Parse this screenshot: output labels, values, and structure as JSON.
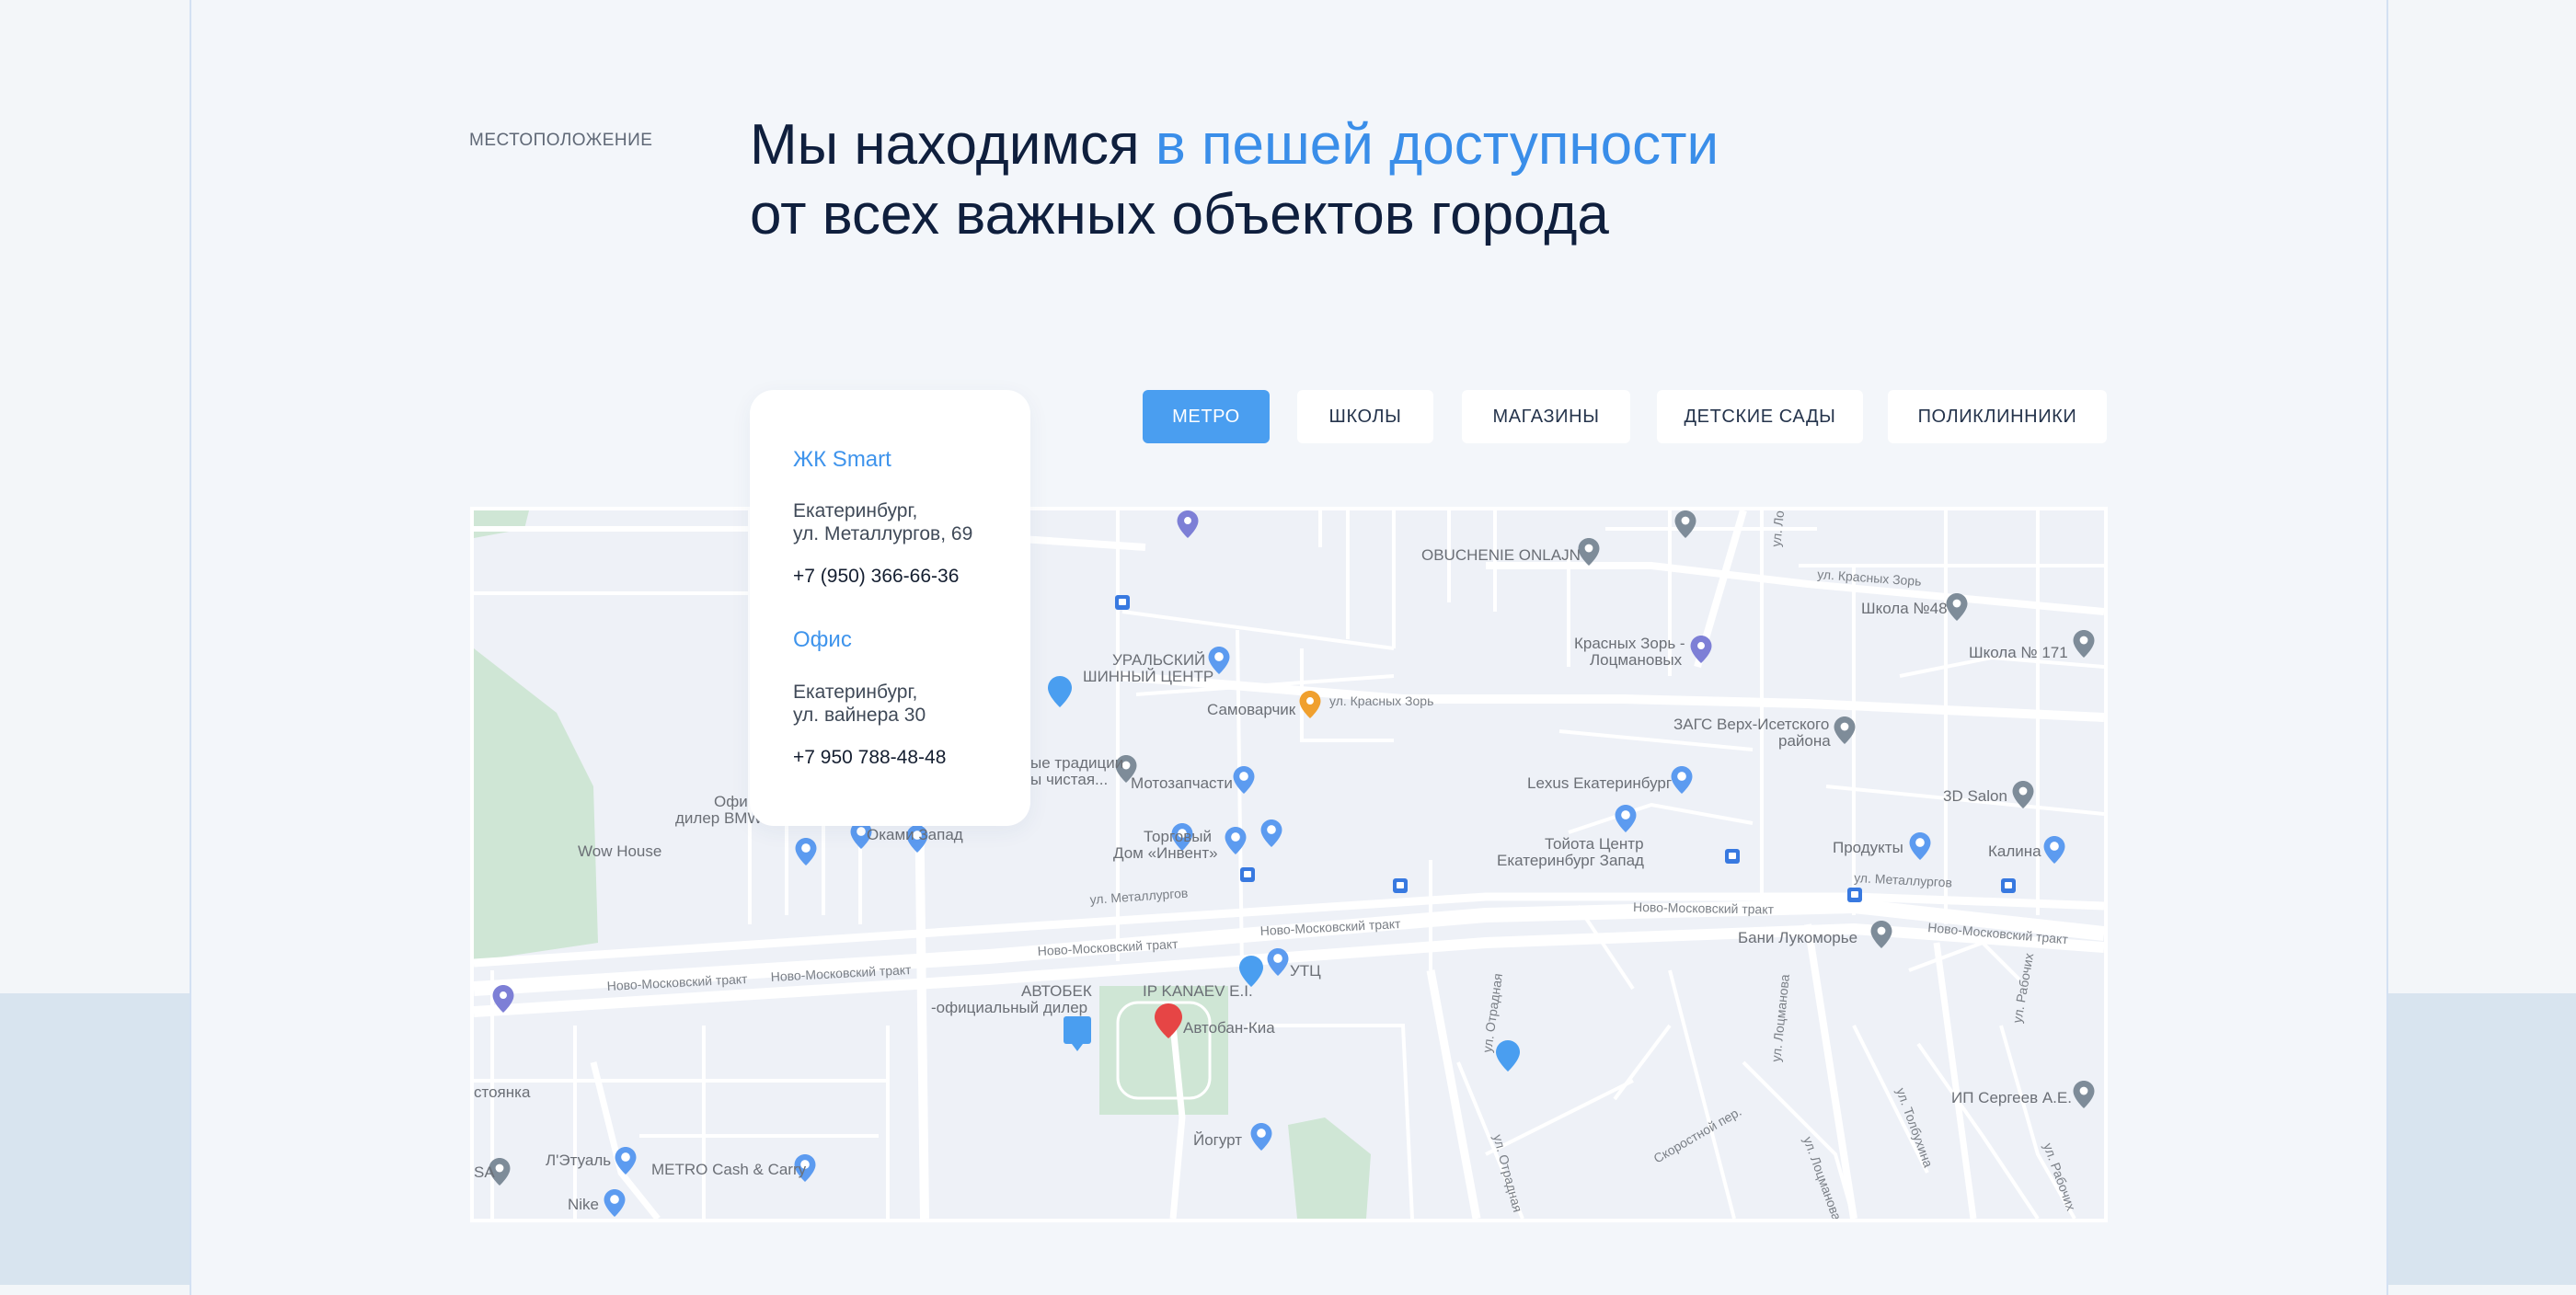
{
  "section": {
    "label": "МЕСТОПОЛОЖЕНИЕ",
    "title_part1": "Мы находимся ",
    "title_accent": "в пешей доступности",
    "title_line2": "от всех важных объектов города"
  },
  "tabs": [
    {
      "label": "МЕТРО",
      "active": true
    },
    {
      "label": "ШКОЛЫ",
      "active": false
    },
    {
      "label": "МАГАЗИНЫ",
      "active": false
    },
    {
      "label": "ДЕТСКИЕ САДЫ",
      "active": false
    },
    {
      "label": "ПОЛИКЛИННИКИ",
      "active": false
    }
  ],
  "info": {
    "place1": {
      "name": "ЖК Smart",
      "addr1": "Екатеринбург,",
      "addr2": "ул. Металлургов, 69",
      "phone": "+7 (950) 366-66-36"
    },
    "place2": {
      "name": "Офис",
      "addr1": "Екатеринбург,",
      "addr2": "ул. вайнера 30",
      "phone": "+7 950 788-48-48"
    }
  },
  "map": {
    "pois": {
      "obuchenie": "OBUCHENIE ONLAJN",
      "uralsky1": "УРАЛЬСКИЙ",
      "uralsky2": "ШИННЫЙ ЦЕНТР",
      "samovarchik": "Самоварчик",
      "tradicii1": "ые традиции",
      "tradicii2": "ы чистая...",
      "motozap": "Мотозапчасти",
      "torg1": "Торговый",
      "torg2": "Дом «Инвент»",
      "okami": "Оками Запад",
      "wowhouse": "Wow House",
      "ofic1": "Офи",
      "ofic2": "дилер BMW",
      "krasnye1": "Красных Зорь -",
      "krasnye2": "Лоцмановых",
      "zags1": "ЗАГС Верх-Исетского",
      "zags2": "района",
      "shkola48": "Школа №48",
      "shkola171": "Школа № 171",
      "lexus": "Lexus Екатеринбург",
      "toyota1": "Тойота Центр",
      "toyota2": "Екатеринбург Запад",
      "salon3d": "3D Salon",
      "produkty": "Продукты",
      "kalina": "Калина",
      "bani": "Бани Лукоморье",
      "avtobek1": "АВТОБЕК",
      "avtobek2": "-официальный дилер",
      "kanaev": "IP KANAEV E.I.",
      "utc": "УТЦ",
      "avtoban": "Автобан-Киа",
      "yogurt": "Йогурт",
      "ip_sergeev": "ИП Сергеев А.Е.",
      "letual": "Л'Этуаль",
      "metro_cc": "METRO Cash & Carry",
      "nike": "Nike",
      "stoyanka": "стоянка",
      "sa": "SA"
    },
    "streets": {
      "metallurgov1": "ул. Металлургов",
      "metallurgov2": "ул. Металлургов",
      "nm1": "Ново-Московский тракт",
      "nm2": "Ново-Московский тракт",
      "nm3": "Ново-Московский тракт",
      "nm4": "Ново-Московский тракт",
      "nm5": "Ново-Московский тракт",
      "nm6": "Ново-Московский тракт",
      "krasnyh_zor1": "ул. Красных Зорь",
      "krasnyh_zor2": "ул. Красных Зорь",
      "otradnaya1": "ул. Отрадная",
      "otradnaya2": "ул. Отрадная",
      "locmanova1": "ул. Лоцманова",
      "locmanova2": "ул. Лоцманова",
      "skorostnoy": "Скоростной пер.",
      "tolbuhina": "ул. Толбухина",
      "rabochih1": "ул. Рабочих",
      "rabochih2": "ул. Рабочих",
      "lots": "ул. Лоц"
    }
  },
  "colors": {
    "accent": "#3a8ee9",
    "tab_active": "#4a9ef0",
    "marker_main": "#e64545",
    "marker_blue": "#4a9ef0"
  }
}
